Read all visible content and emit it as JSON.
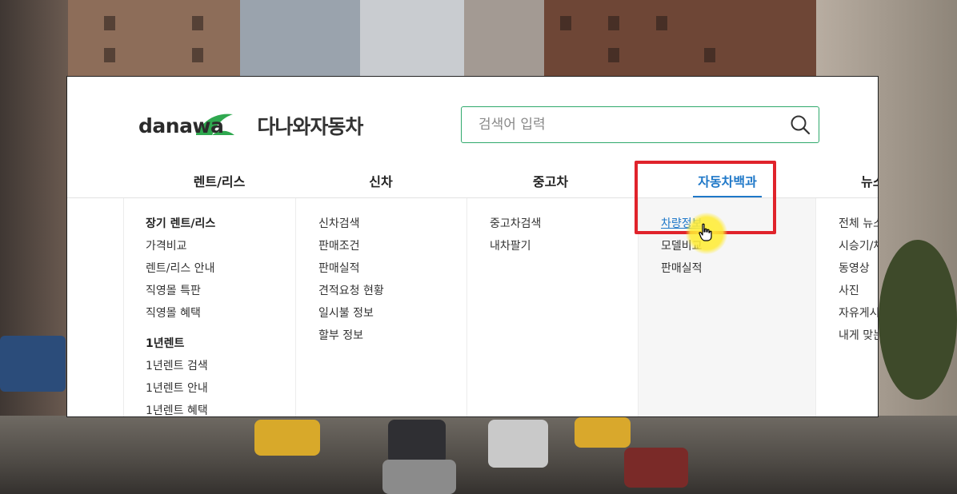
{
  "header": {
    "logo_text": "danawa",
    "logo_kor": "다나와자동차"
  },
  "search": {
    "placeholder": "검색어 입력",
    "icon": "search-icon"
  },
  "nav": {
    "items": [
      {
        "label": "렌트/리스"
      },
      {
        "label": "신차"
      },
      {
        "label": "중고차"
      },
      {
        "label": "자동차백과",
        "active": true
      },
      {
        "label": "뉴스"
      }
    ]
  },
  "menu": {
    "rent_lease": {
      "items": [
        "장기 렌트/리스",
        "가격비교",
        "렌트/리스 안내",
        "직영몰 특판",
        "직영몰 혜택",
        "1년렌트",
        "1년렌트 검색",
        "1년렌트 안내",
        "1년렌트 혜택"
      ]
    },
    "new_car": {
      "items": [
        "신차검색",
        "판매조건",
        "판매실적",
        "견적요청 현황",
        "일시불 정보",
        "할부 정보"
      ]
    },
    "used_car": {
      "items": [
        "중고차검색",
        "내차팔기"
      ]
    },
    "encyclopedia": {
      "items": [
        "차량정보",
        "모델비교",
        "판매실적"
      ]
    },
    "news": {
      "items": [
        "전체 뉴스",
        "시승기/체",
        "동영상",
        "사진",
        "자유게시",
        "내게 맞는"
      ]
    }
  },
  "colors": {
    "accent": "#1f78c8",
    "brand_green": "#2fa96c",
    "highlight_red": "#e0232b"
  }
}
